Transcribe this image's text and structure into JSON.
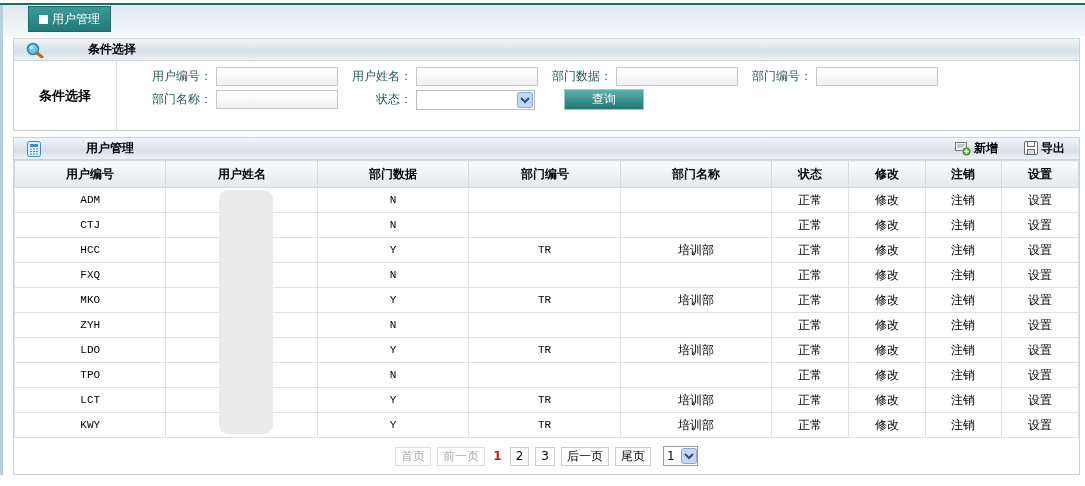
{
  "tab": {
    "label": "用户管理",
    "selected": true
  },
  "filter": {
    "title": "条件选择",
    "side_label": "条件选择",
    "fields": [
      {
        "label": "用户编号：",
        "kind": "text"
      },
      {
        "label": "用户姓名：",
        "kind": "text"
      },
      {
        "label": "部门数据：",
        "kind": "text"
      },
      {
        "label": "部门编号：",
        "kind": "text"
      },
      {
        "label": "部门名称：",
        "kind": "text"
      },
      {
        "label": "状态：",
        "kind": "select"
      }
    ],
    "search_button": "查询"
  },
  "table_panel": {
    "title": "用户管理",
    "actions": [
      {
        "label": "新增",
        "kind": "add"
      },
      {
        "label": "导出",
        "kind": "export"
      }
    ]
  },
  "columns": [
    "用户编号",
    "用户姓名",
    "部门数据",
    "部门编号",
    "部门名称",
    "状态",
    "修改",
    "注销",
    "设置"
  ],
  "rows": [
    [
      "ADM",
      "",
      "N",
      "",
      "",
      "正常",
      "修改",
      "注销",
      "设置"
    ],
    [
      "CTJ",
      "",
      "N",
      "",
      "",
      "正常",
      "修改",
      "注销",
      "设置"
    ],
    [
      "HCC",
      "",
      "Y",
      "TR",
      "培训部",
      "正常",
      "修改",
      "注销",
      "设置"
    ],
    [
      "FXQ",
      "",
      "N",
      "",
      "",
      "正常",
      "修改",
      "注销",
      "设置"
    ],
    [
      "MKO",
      "",
      "Y",
      "TR",
      "培训部",
      "正常",
      "修改",
      "注销",
      "设置"
    ],
    [
      "ZYH",
      "",
      "N",
      "",
      "",
      "正常",
      "修改",
      "注销",
      "设置"
    ],
    [
      "LDO",
      "",
      "Y",
      "TR",
      "培训部",
      "正常",
      "修改",
      "注销",
      "设置"
    ],
    [
      "TPO",
      "",
      "N",
      "",
      "",
      "正常",
      "修改",
      "注销",
      "设置"
    ],
    [
      "LCT",
      "",
      "Y",
      "TR",
      "培训部",
      "正常",
      "修改",
      "注销",
      "设置"
    ],
    [
      "KWY",
      "",
      "Y",
      "TR",
      "培训部",
      "正常",
      "修改",
      "注销",
      "设置"
    ]
  ],
  "pagination": {
    "nav_before": [
      {
        "label": "首页",
        "disabled": true
      },
      {
        "label": "前一页",
        "disabled": true
      }
    ],
    "pages": [
      {
        "label": "1",
        "selected": true
      },
      {
        "label": "2",
        "selected": false
      },
      {
        "label": "3",
        "selected": false
      }
    ],
    "nav_after": [
      {
        "label": "后一页",
        "disabled": false
      },
      {
        "label": "尾页",
        "disabled": false
      }
    ],
    "page_select": "1"
  }
}
